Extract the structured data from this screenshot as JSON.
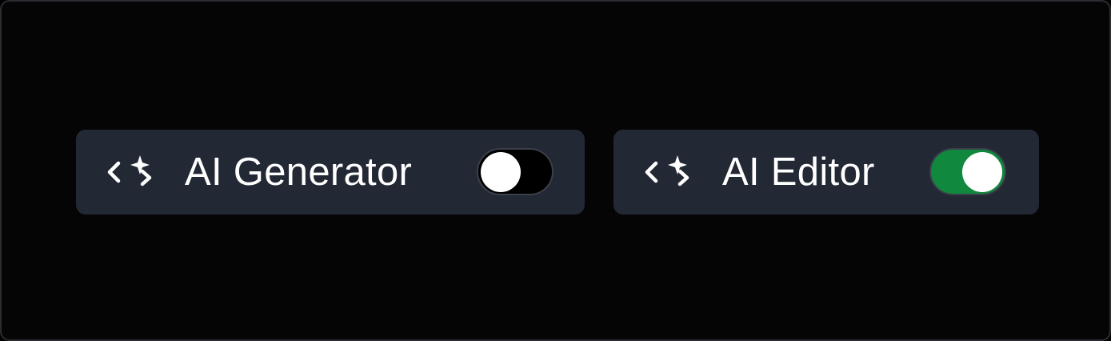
{
  "toggles": [
    {
      "label": "AI Generator",
      "icon": "code-sparkle-icon",
      "state": "off"
    },
    {
      "label": "AI Editor",
      "icon": "code-sparkle-icon",
      "state": "on"
    }
  ],
  "colors": {
    "background": "#050505",
    "chip": "#222834",
    "toggle_on": "#10893e",
    "toggle_off": "#000000",
    "knob": "#ffffff",
    "text": "#ffffff"
  }
}
